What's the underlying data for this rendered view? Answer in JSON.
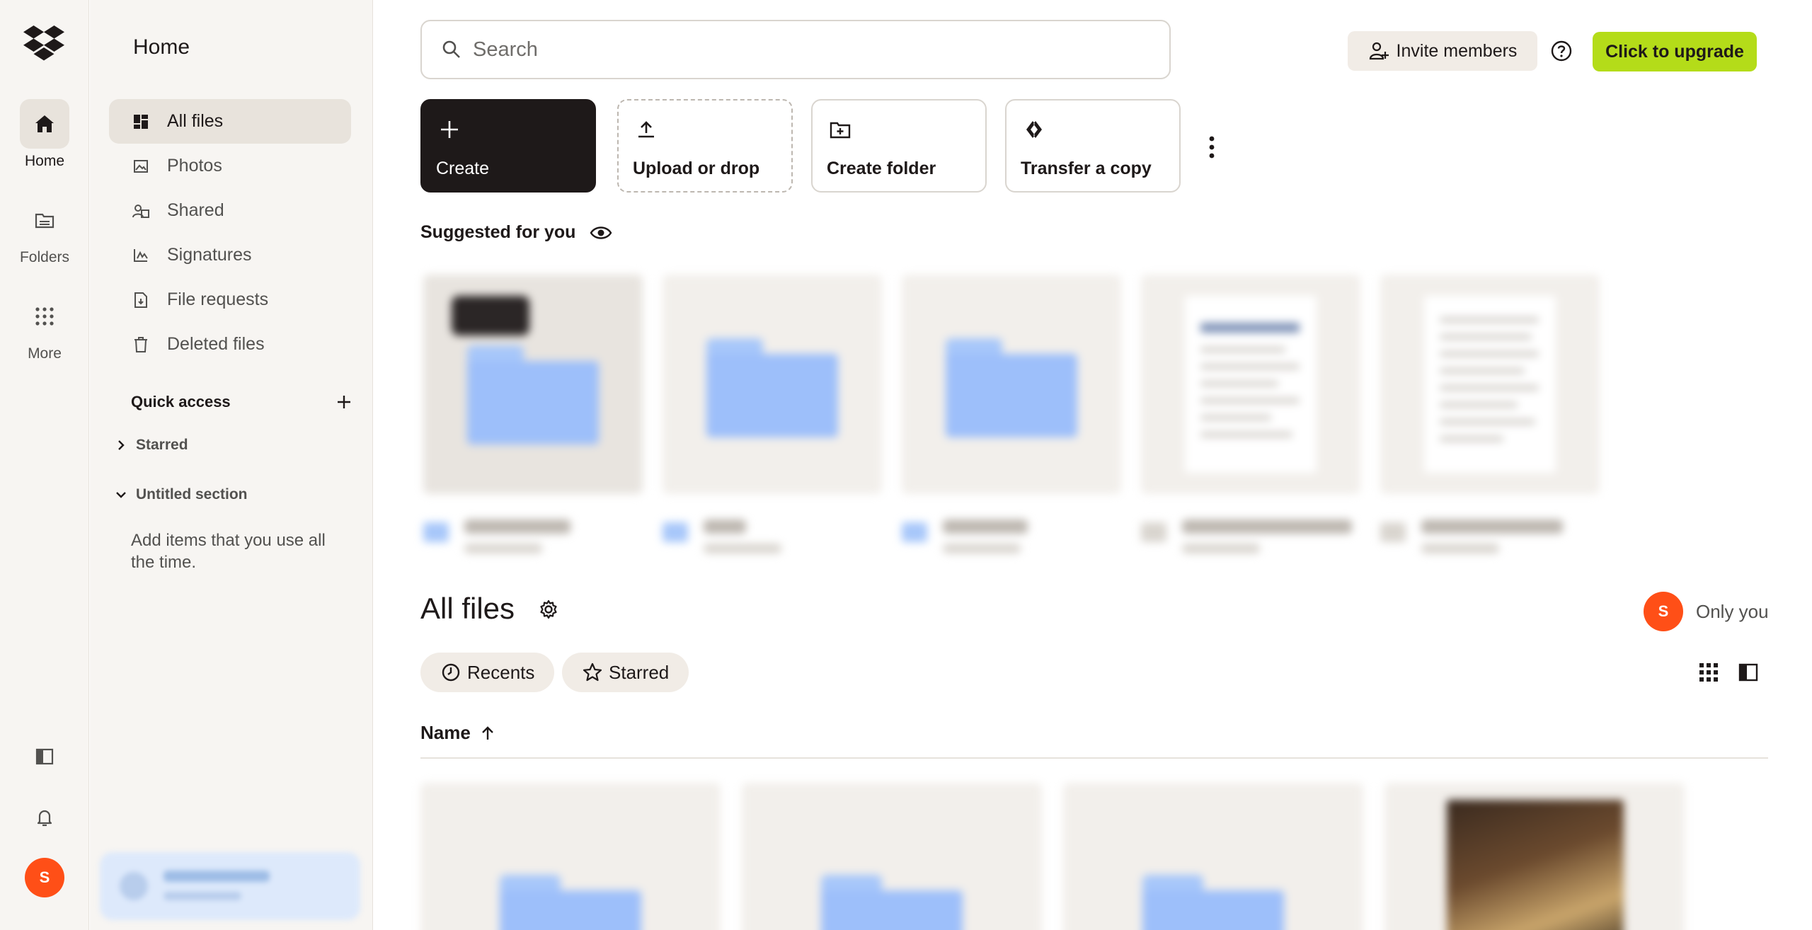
{
  "rail": {
    "items": [
      {
        "label": "Home",
        "icon": "home-icon"
      },
      {
        "label": "Folders",
        "icon": "folder-icon"
      },
      {
        "label": "More",
        "icon": "grid-icon"
      }
    ],
    "bottom": {
      "avatar_initial": "S"
    }
  },
  "sidebar": {
    "title": "Home",
    "nav": [
      {
        "label": "All files",
        "icon": "all-files-icon"
      },
      {
        "label": "Photos",
        "icon": "photos-icon"
      },
      {
        "label": "Shared",
        "icon": "shared-icon"
      },
      {
        "label": "Signatures",
        "icon": "signatures-icon"
      },
      {
        "label": "File requests",
        "icon": "file-requests-icon"
      },
      {
        "label": "Deleted files",
        "icon": "trash-icon"
      }
    ],
    "quick_access": {
      "title": "Quick access",
      "sections": [
        {
          "label": "Starred",
          "expanded": false
        },
        {
          "label": "Untitled section",
          "expanded": true
        }
      ],
      "hint": "Add items that you use all the time."
    }
  },
  "header": {
    "search_placeholder": "Search",
    "invite_label": "Invite members",
    "upgrade_label": "Click to upgrade"
  },
  "actions": [
    {
      "label": "Create",
      "icon": "plus-icon"
    },
    {
      "label": "Upload or drop",
      "icon": "upload-icon"
    },
    {
      "label": "Create folder",
      "icon": "folder-plus-icon"
    },
    {
      "label": "Transfer a copy",
      "icon": "transfer-icon"
    }
  ],
  "suggested": {
    "title": "Suggested for you"
  },
  "all_files": {
    "title": "All files",
    "sharing": {
      "avatar_initial": "S",
      "label": "Only you"
    },
    "filters": [
      {
        "label": "Recents",
        "icon": "clock-icon"
      },
      {
        "label": "Starred",
        "icon": "star-icon"
      }
    ],
    "column_header": "Name"
  },
  "colors": {
    "accent_upgrade": "#b4dc19",
    "avatar": "#ff4f17",
    "folder_blue": "#9dbffa",
    "dark_button": "#1e1919"
  }
}
